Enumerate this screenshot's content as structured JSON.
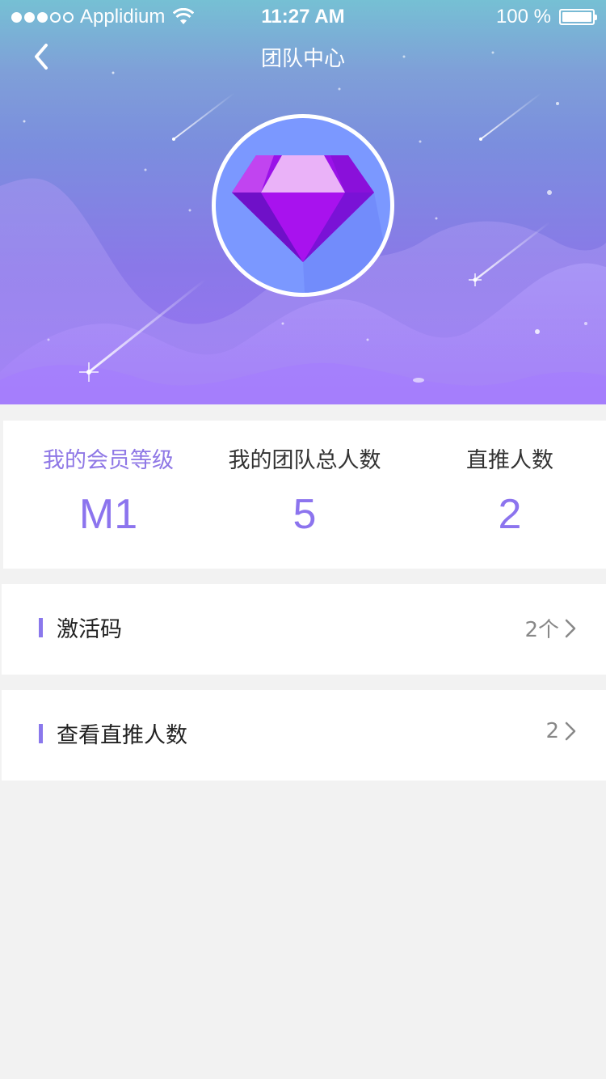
{
  "status_bar": {
    "carrier": "Applidium",
    "time": "11:27 AM",
    "battery": "100 %"
  },
  "navbar": {
    "title": "团队中心",
    "back_icon": "chevron-left-icon"
  },
  "hero": {
    "badge_icon": "diamond-icon"
  },
  "stats": [
    {
      "label": "我的会员等级",
      "value": "M1"
    },
    {
      "label": "我的团队总人数",
      "value": "5"
    },
    {
      "label": "直推人数",
      "value": "2"
    }
  ],
  "rows": [
    {
      "label": "激活码",
      "value": "2个"
    },
    {
      "label": "查看直推人数",
      "value": "2"
    }
  ],
  "colors": {
    "accent": "#8c74ee",
    "background": "#f2f2f2"
  }
}
